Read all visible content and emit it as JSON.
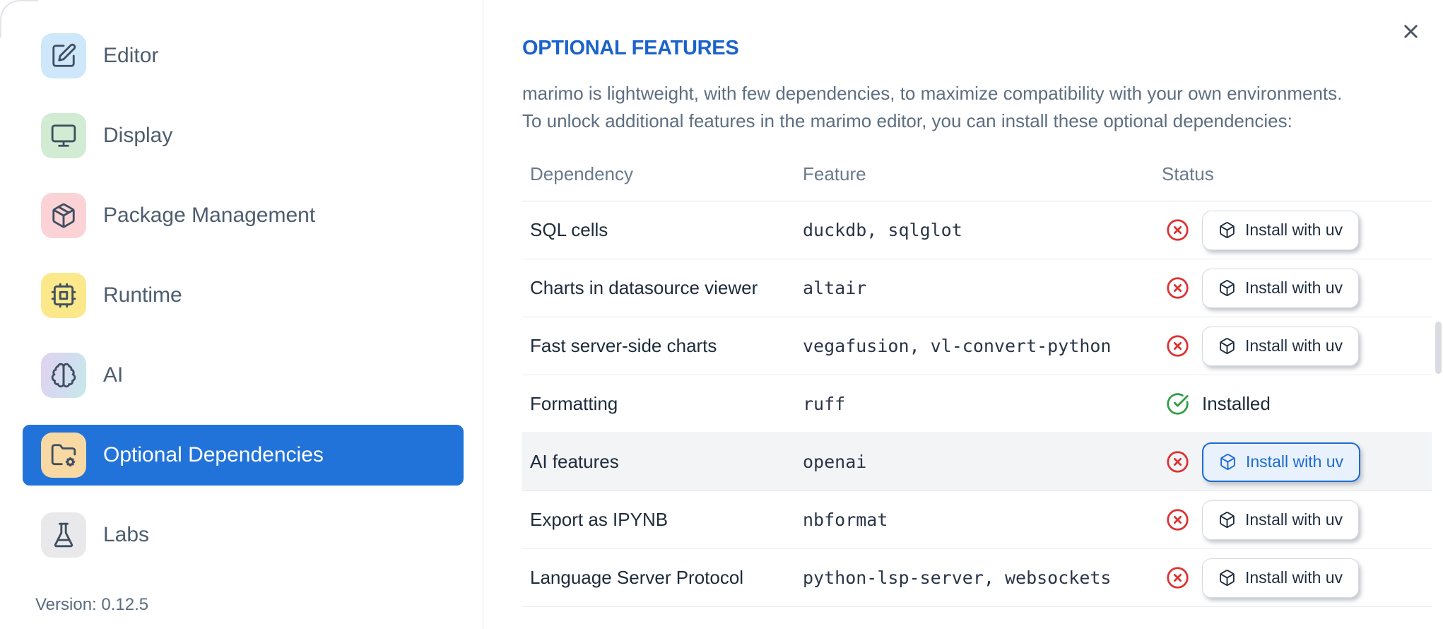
{
  "sidebar": {
    "items": [
      {
        "label": "Editor",
        "icon": "editor",
        "icon_bg": "#cfe7fb",
        "active": false
      },
      {
        "label": "Display",
        "icon": "display",
        "icon_bg": "#d2ecd4",
        "active": false
      },
      {
        "label": "Package Management",
        "icon": "package",
        "icon_bg": "#fbd3d6",
        "active": false
      },
      {
        "label": "Runtime",
        "icon": "runtime",
        "icon_bg": "#fbe88a",
        "active": false
      },
      {
        "label": "AI",
        "icon": "ai",
        "icon_bg": "linear-gradient(105deg,#e2d2f0 0%,#d2ddf0 55%,#c6e9e9 100%)",
        "active": false
      },
      {
        "label": "Optional Dependencies",
        "icon": "optional-deps",
        "icon_bg": "#f8d9a4",
        "active": true
      },
      {
        "label": "Labs",
        "icon": "labs",
        "icon_bg": "#e9e9eb",
        "active": false
      }
    ],
    "version": "Version: 0.12.5"
  },
  "dialog": {
    "title": "OPTIONAL FEATURES",
    "description_lines": [
      "marimo is lightweight, with few dependencies, to maximize compatibility with your own environments.",
      "To unlock additional features in the marimo editor, you can install these optional dependencies:"
    ],
    "close_icon": "close-icon",
    "table": {
      "columns": [
        "Dependency",
        "Feature",
        "Status"
      ],
      "install_button_label": "Install with uv",
      "installed_label": "Installed",
      "rows": [
        {
          "dependency": "SQL cells",
          "feature": "duckdb, sqlglot",
          "installed": false,
          "highlighted": false
        },
        {
          "dependency": "Charts in datasource viewer",
          "feature": "altair",
          "installed": false,
          "highlighted": false
        },
        {
          "dependency": "Fast server-side charts",
          "feature": "vegafusion, vl-convert-python",
          "installed": false,
          "highlighted": false
        },
        {
          "dependency": "Formatting",
          "feature": "ruff",
          "installed": true,
          "highlighted": false
        },
        {
          "dependency": "AI features",
          "feature": "openai",
          "installed": false,
          "highlighted": true
        },
        {
          "dependency": "Export as IPYNB",
          "feature": "nbformat",
          "installed": false,
          "highlighted": false
        },
        {
          "dependency": "Language Server Protocol",
          "feature": "python-lsp-server, websockets",
          "installed": false,
          "highlighted": false
        }
      ]
    }
  },
  "colors": {
    "accent_blue": "#2173da",
    "title_blue": "#1b63cb",
    "error_red": "#dc3232",
    "success_green": "#2f9e44",
    "highlighted_row_bg": "#f3f4f6",
    "sidebar_text": "#4d5d6f"
  }
}
